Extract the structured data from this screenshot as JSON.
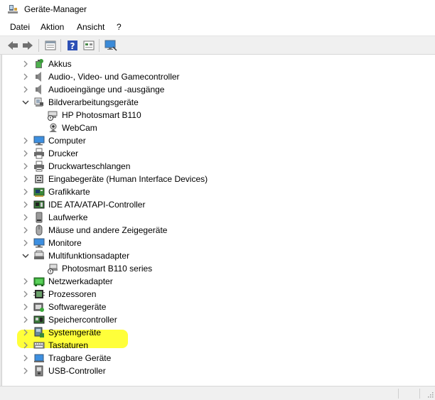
{
  "window": {
    "title": "Geräte-Manager"
  },
  "menu": [
    {
      "label": "Datei"
    },
    {
      "label": "Aktion"
    },
    {
      "label": "Ansicht"
    },
    {
      "label": "?"
    }
  ],
  "toolbar": {
    "buttons": [
      "back-icon",
      "forward-icon",
      "properties-icon",
      "help-icon",
      "view-icon",
      "monitor-icon"
    ]
  },
  "tree": {
    "items": [
      {
        "label": "Akkus",
        "level": 0,
        "expanded": false,
        "icon": "battery-icon"
      },
      {
        "label": "Audio-, Video- und Gamecontroller",
        "level": 0,
        "expanded": false,
        "icon": "speaker-icon"
      },
      {
        "label": "Audioeingänge und -ausgänge",
        "level": 0,
        "expanded": false,
        "icon": "speaker-icon"
      },
      {
        "label": "Bildverarbeitungsgeräte",
        "level": 0,
        "expanded": true,
        "icon": "camera-icon"
      },
      {
        "label": "HP Photosmart B110",
        "level": 1,
        "icon": "scanner-warning-icon"
      },
      {
        "label": "WebCam",
        "level": 1,
        "icon": "webcam-icon"
      },
      {
        "label": "Computer",
        "level": 0,
        "expanded": false,
        "icon": "computer-icon"
      },
      {
        "label": "Drucker",
        "level": 0,
        "expanded": false,
        "icon": "printer-icon"
      },
      {
        "label": "Druckwarteschlangen",
        "level": 0,
        "expanded": false,
        "icon": "printer-queue-icon"
      },
      {
        "label": "Eingabegeräte (Human Interface Devices)",
        "level": 0,
        "expanded": false,
        "icon": "hid-icon"
      },
      {
        "label": "Grafikkarte",
        "level": 0,
        "expanded": false,
        "icon": "display-adapter-icon"
      },
      {
        "label": "IDE ATA/ATAPI-Controller",
        "level": 0,
        "expanded": false,
        "icon": "ide-controller-icon"
      },
      {
        "label": "Laufwerke",
        "level": 0,
        "expanded": false,
        "icon": "disk-drive-icon"
      },
      {
        "label": "Mäuse und andere Zeigegeräte",
        "level": 0,
        "expanded": false,
        "icon": "mouse-icon"
      },
      {
        "label": "Monitore",
        "level": 0,
        "expanded": false,
        "icon": "monitor-icon"
      },
      {
        "label": "Multifunktionsadapter",
        "level": 0,
        "expanded": true,
        "icon": "multifunction-icon"
      },
      {
        "label": "Photosmart B110 series",
        "level": 1,
        "icon": "multifunction-warning-icon"
      },
      {
        "label": "Netzwerkadapter",
        "level": 0,
        "expanded": false,
        "icon": "network-adapter-icon",
        "highlighted": true
      },
      {
        "label": "Prozessoren",
        "level": 0,
        "expanded": false,
        "icon": "processor-icon"
      },
      {
        "label": "Softwaregeräte",
        "level": 0,
        "expanded": false,
        "icon": "software-device-icon"
      },
      {
        "label": "Speichercontroller",
        "level": 0,
        "expanded": false,
        "icon": "storage-controller-icon"
      },
      {
        "label": "Systemgeräte",
        "level": 0,
        "expanded": false,
        "icon": "system-device-icon"
      },
      {
        "label": "Tastaturen",
        "level": 0,
        "expanded": false,
        "icon": "keyboard-icon"
      },
      {
        "label": "Tragbare Geräte",
        "level": 0,
        "expanded": false,
        "icon": "portable-device-icon"
      },
      {
        "label": "USB-Controller",
        "level": 0,
        "expanded": false,
        "icon": "usb-icon"
      }
    ]
  },
  "colors": {
    "highlight": "#ffff3a",
    "toolbar_bg": "#f0f0f0",
    "chevron": "#7a7a7a"
  }
}
